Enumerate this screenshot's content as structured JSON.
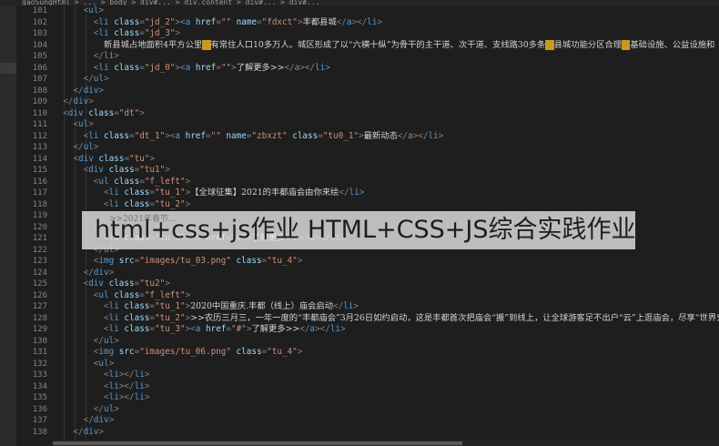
{
  "window": {
    "breadcrumb": "gaoSungHtml > ... > body > div#... > div.content > div#... > div#..."
  },
  "editor": {
    "lines": [
      {
        "n": "101",
        "indent": 6,
        "tokens": [
          [
            "p",
            "<"
          ],
          [
            "tag",
            "ul"
          ],
          [
            "p",
            ">"
          ]
        ]
      },
      {
        "n": "102",
        "indent": 8,
        "tokens": [
          [
            "p",
            "<"
          ],
          [
            "tag",
            "li"
          ],
          [
            "attr",
            " class"
          ],
          [
            "p",
            "="
          ],
          [
            "str",
            "\"jd_2\""
          ],
          [
            "p",
            "><"
          ],
          [
            "tag",
            "a"
          ],
          [
            "attr",
            " href"
          ],
          [
            "p",
            "="
          ],
          [
            "str",
            "\"\""
          ],
          [
            "attr",
            " name"
          ],
          [
            "p",
            "="
          ],
          [
            "str",
            "\"fdxct\""
          ],
          [
            "p",
            ">"
          ],
          [
            "txt",
            "丰都县城"
          ],
          [
            "p",
            "</"
          ],
          [
            "tag",
            "a"
          ],
          [
            "p",
            "></"
          ],
          [
            "tag",
            "li"
          ],
          [
            "p",
            ">"
          ]
        ]
      },
      {
        "n": "103",
        "indent": 8,
        "tokens": [
          [
            "p",
            "<"
          ],
          [
            "tag",
            "li"
          ],
          [
            "attr",
            " class"
          ],
          [
            "p",
            "="
          ],
          [
            "str",
            "\"jd_3\""
          ],
          [
            "p",
            ">"
          ]
        ]
      },
      {
        "n": "104",
        "indent": 10,
        "tokens": [
          [
            "txt",
            "新县城占地面积4平方公里"
          ],
          [
            "hl",
            "，"
          ],
          [
            "txt",
            "有常住人口10多万人。城区形成了以“六横十纵”为骨干的主干道、次干道、支线路30多条"
          ],
          [
            "hl",
            "，"
          ],
          [
            "txt",
            "县城功能分区合理"
          ],
          [
            "hl",
            "，"
          ],
          [
            "txt",
            "基础设施、公益设施和"
          ]
        ]
      },
      {
        "n": "105",
        "indent": 8,
        "tokens": [
          [
            "p",
            "</"
          ],
          [
            "tag",
            "li"
          ],
          [
            "p",
            ">"
          ]
        ]
      },
      {
        "n": "106",
        "indent": 8,
        "tokens": [
          [
            "p",
            "<"
          ],
          [
            "tag",
            "li"
          ],
          [
            "attr",
            " class"
          ],
          [
            "p",
            "="
          ],
          [
            "str",
            "\"jd_0\""
          ],
          [
            "p",
            "><"
          ],
          [
            "tag",
            "a"
          ],
          [
            "attr",
            " href"
          ],
          [
            "p",
            "="
          ],
          [
            "str",
            "\"\""
          ],
          [
            "p",
            ">"
          ],
          [
            "txt",
            "了解更多>>"
          ],
          [
            "p",
            "</"
          ],
          [
            "tag",
            "a"
          ],
          [
            "p",
            "></"
          ],
          [
            "tag",
            "li"
          ],
          [
            "p",
            ">"
          ]
        ]
      },
      {
        "n": "107",
        "indent": 6,
        "tokens": [
          [
            "p",
            "</"
          ],
          [
            "tag",
            "ul"
          ],
          [
            "p",
            ">"
          ]
        ]
      },
      {
        "n": "108",
        "indent": 4,
        "tokens": [
          [
            "p",
            "</"
          ],
          [
            "tag",
            "div"
          ],
          [
            "p",
            ">"
          ]
        ]
      },
      {
        "n": "109",
        "indent": 2,
        "tokens": [
          [
            "p",
            "</"
          ],
          [
            "tag",
            "div"
          ],
          [
            "p",
            ">"
          ]
        ]
      },
      {
        "n": "110",
        "indent": 2,
        "tokens": [
          [
            "p",
            "<"
          ],
          [
            "tag",
            "div"
          ],
          [
            "attr",
            " class"
          ],
          [
            "p",
            "="
          ],
          [
            "str",
            "\"dt\""
          ],
          [
            "p",
            ">"
          ]
        ]
      },
      {
        "n": "111",
        "indent": 4,
        "tokens": [
          [
            "p",
            "<"
          ],
          [
            "tag",
            "ul"
          ],
          [
            "p",
            ">"
          ]
        ]
      },
      {
        "n": "112",
        "indent": 6,
        "tokens": [
          [
            "p",
            "<"
          ],
          [
            "tag",
            "li"
          ],
          [
            "attr",
            " class"
          ],
          [
            "p",
            "="
          ],
          [
            "str",
            "\"dt_1\""
          ],
          [
            "p",
            "><"
          ],
          [
            "tag",
            "a"
          ],
          [
            "attr",
            " href"
          ],
          [
            "p",
            "="
          ],
          [
            "str",
            "\"\""
          ],
          [
            "attr",
            " name"
          ],
          [
            "p",
            "="
          ],
          [
            "str",
            "\"zbxzt\""
          ],
          [
            "attr",
            " class"
          ],
          [
            "p",
            "="
          ],
          [
            "str",
            "\"tu0_1\""
          ],
          [
            "p",
            ">"
          ],
          [
            "txt",
            "最新动态"
          ],
          [
            "p",
            "</"
          ],
          [
            "tag",
            "a"
          ],
          [
            "p",
            "></"
          ],
          [
            "tag",
            "li"
          ],
          [
            "p",
            ">"
          ]
        ]
      },
      {
        "n": "113",
        "indent": 4,
        "tokens": [
          [
            "p",
            "</"
          ],
          [
            "tag",
            "ul"
          ],
          [
            "p",
            ">"
          ]
        ]
      },
      {
        "n": "114",
        "indent": 4,
        "tokens": [
          [
            "p",
            "<"
          ],
          [
            "tag",
            "div"
          ],
          [
            "attr",
            " class"
          ],
          [
            "p",
            "="
          ],
          [
            "str",
            "\"tu\""
          ],
          [
            "p",
            ">"
          ]
        ]
      },
      {
        "n": "115",
        "indent": 6,
        "tokens": [
          [
            "p",
            "<"
          ],
          [
            "tag",
            "div"
          ],
          [
            "attr",
            " class"
          ],
          [
            "p",
            "="
          ],
          [
            "str",
            "\"tu1\""
          ],
          [
            "p",
            ">"
          ]
        ]
      },
      {
        "n": "116",
        "indent": 8,
        "tokens": [
          [
            "p",
            "<"
          ],
          [
            "tag",
            "ul"
          ],
          [
            "attr",
            " class"
          ],
          [
            "p",
            "="
          ],
          [
            "str",
            "\"f_left\""
          ],
          [
            "p",
            ">"
          ]
        ]
      },
      {
        "n": "117",
        "indent": 10,
        "tokens": [
          [
            "p",
            "<"
          ],
          [
            "tag",
            "li"
          ],
          [
            "attr",
            " class"
          ],
          [
            "p",
            "="
          ],
          [
            "str",
            "\"tu_1\""
          ],
          [
            "p",
            ">"
          ],
          [
            "txt",
            "【全球征集】2021的丰都庙会由你来绘"
          ],
          [
            "p",
            "</"
          ],
          [
            "tag",
            "li"
          ],
          [
            "p",
            ">"
          ]
        ]
      },
      {
        "n": "118",
        "indent": 10,
        "tokens": [
          [
            "p",
            "<"
          ],
          [
            "tag",
            "li"
          ],
          [
            "attr",
            " class"
          ],
          [
            "p",
            "="
          ],
          [
            "str",
            "\"tu_2\""
          ],
          [
            "p",
            ">"
          ]
        ]
      },
      {
        "n": "119",
        "indent": 12,
        "tokens": []
      },
      {
        "n": "120",
        "indent": 10,
        "tokens": []
      },
      {
        "n": "121",
        "indent": 10,
        "tokens": [
          [
            "p",
            "<"
          ],
          [
            "tag",
            "li"
          ],
          [
            "attr",
            " class"
          ],
          [
            "p",
            "="
          ],
          [
            "str",
            "\"tu_3\""
          ],
          [
            "p",
            "><"
          ],
          [
            "tag",
            "a"
          ],
          [
            "attr",
            " href"
          ],
          [
            "p",
            "="
          ],
          [
            "str",
            "\"#\""
          ],
          [
            "p",
            ">"
          ],
          [
            "txt",
            "了解更多>>"
          ],
          [
            "p",
            "</"
          ],
          [
            "tag",
            "a"
          ],
          [
            "p",
            "></"
          ],
          [
            "tag",
            "li"
          ],
          [
            "p",
            ">"
          ]
        ]
      },
      {
        "n": "122",
        "indent": 8,
        "tokens": [
          [
            "p",
            "</"
          ],
          [
            "tag",
            "ul"
          ],
          [
            "p",
            ">"
          ]
        ]
      },
      {
        "n": "123",
        "indent": 8,
        "tokens": [
          [
            "p",
            "<"
          ],
          [
            "tag",
            "img"
          ],
          [
            "attr",
            " src"
          ],
          [
            "p",
            "="
          ],
          [
            "str",
            "\"images/tu_03.png\""
          ],
          [
            "attr",
            " class"
          ],
          [
            "p",
            "="
          ],
          [
            "str",
            "\"tu_4\""
          ],
          [
            "p",
            ">"
          ]
        ]
      },
      {
        "n": "124",
        "indent": 6,
        "tokens": [
          [
            "p",
            "</"
          ],
          [
            "tag",
            "div"
          ],
          [
            "p",
            ">"
          ]
        ]
      },
      {
        "n": "125",
        "indent": 6,
        "tokens": [
          [
            "p",
            "<"
          ],
          [
            "tag",
            "div"
          ],
          [
            "attr",
            " class"
          ],
          [
            "p",
            "="
          ],
          [
            "str",
            "\"tu2\""
          ],
          [
            "p",
            ">"
          ]
        ]
      },
      {
        "n": "126",
        "indent": 8,
        "tokens": [
          [
            "p",
            "<"
          ],
          [
            "tag",
            "ul"
          ],
          [
            "attr",
            " class"
          ],
          [
            "p",
            "="
          ],
          [
            "str",
            "\"f_left\""
          ],
          [
            "p",
            ">"
          ]
        ]
      },
      {
        "n": "127",
        "indent": 10,
        "tokens": [
          [
            "p",
            "<"
          ],
          [
            "tag",
            "li"
          ],
          [
            "attr",
            " class"
          ],
          [
            "p",
            "="
          ],
          [
            "str",
            "\"tu_1\""
          ],
          [
            "p",
            ">"
          ],
          [
            "txt",
            "2020中国重庆.丰都（线上）庙会启动"
          ],
          [
            "p",
            "</"
          ],
          [
            "tag",
            "li"
          ],
          [
            "p",
            ">"
          ]
        ]
      },
      {
        "n": "128",
        "indent": 10,
        "tokens": [
          [
            "p",
            "<"
          ],
          [
            "tag",
            "li"
          ],
          [
            "attr",
            " class"
          ],
          [
            "p",
            "="
          ],
          [
            "str",
            "\"tu_2\""
          ],
          [
            "p",
            ">"
          ],
          [
            "txt",
            ">>农历三月三，一年一度的“丰都庙会”3月26日如约启动，这是丰都首次把庙会“搬”到线上，让全球游客足不出户“云”上逛庙会，尽享“世界鬼"
          ]
        ]
      },
      {
        "n": "129",
        "indent": 10,
        "tokens": [
          [
            "p",
            "<"
          ],
          [
            "tag",
            "li"
          ],
          [
            "attr",
            " class"
          ],
          [
            "p",
            "="
          ],
          [
            "str",
            "\"tu_3\""
          ],
          [
            "p",
            "><"
          ],
          [
            "tag",
            "a"
          ],
          [
            "attr",
            " href"
          ],
          [
            "p",
            "="
          ],
          [
            "str",
            "\"#\""
          ],
          [
            "p",
            ">"
          ],
          [
            "txt",
            "了解更多>>"
          ],
          [
            "p",
            "</"
          ],
          [
            "tag",
            "a"
          ],
          [
            "p",
            "></"
          ],
          [
            "tag",
            "li"
          ],
          [
            "p",
            ">"
          ]
        ]
      },
      {
        "n": "130",
        "indent": 8,
        "tokens": [
          [
            "p",
            "</"
          ],
          [
            "tag",
            "ul"
          ],
          [
            "p",
            ">"
          ]
        ]
      },
      {
        "n": "131",
        "indent": 8,
        "tokens": [
          [
            "p",
            "<"
          ],
          [
            "tag",
            "img"
          ],
          [
            "attr",
            " src"
          ],
          [
            "p",
            "="
          ],
          [
            "str",
            "\"images/tu_06.png\""
          ],
          [
            "attr",
            " class"
          ],
          [
            "p",
            "="
          ],
          [
            "str",
            "\"tu_4\""
          ],
          [
            "p",
            ">"
          ]
        ]
      },
      {
        "n": "132",
        "indent": 8,
        "tokens": [
          [
            "p",
            "<"
          ],
          [
            "tag",
            "ul"
          ],
          [
            "p",
            ">"
          ]
        ]
      },
      {
        "n": "133",
        "indent": 10,
        "tokens": [
          [
            "p",
            "<"
          ],
          [
            "tag",
            "li"
          ],
          [
            "p",
            "></"
          ],
          [
            "tag",
            "li"
          ],
          [
            "p",
            ">"
          ]
        ]
      },
      {
        "n": "134",
        "indent": 10,
        "tokens": [
          [
            "p",
            "<"
          ],
          [
            "tag",
            "li"
          ],
          [
            "p",
            "></"
          ],
          [
            "tag",
            "li"
          ],
          [
            "p",
            ">"
          ]
        ]
      },
      {
        "n": "135",
        "indent": 10,
        "tokens": [
          [
            "p",
            "<"
          ],
          [
            "tag",
            "li"
          ],
          [
            "p",
            "></"
          ],
          [
            "tag",
            "li"
          ],
          [
            "p",
            ">"
          ]
        ]
      },
      {
        "n": "136",
        "indent": 8,
        "tokens": [
          [
            "p",
            "</"
          ],
          [
            "tag",
            "ul"
          ],
          [
            "p",
            ">"
          ]
        ]
      },
      {
        "n": "137",
        "indent": 6,
        "tokens": [
          [
            "p",
            "</"
          ],
          [
            "tag",
            "div"
          ],
          [
            "p",
            ">"
          ]
        ]
      },
      {
        "n": "138",
        "indent": 4,
        "tokens": [
          [
            "p",
            "</"
          ],
          [
            "tag",
            "div"
          ],
          [
            "p",
            ">"
          ]
        ]
      }
    ],
    "overlapped_line": ">>2021年春节..."
  },
  "overlay": {
    "title": "html+css+js作业   HTML+CSS+JS综合实践作业集锦"
  },
  "colors": {
    "background": "#1e1e1e",
    "tag": "#569cd6",
    "attribute": "#9cdcfe",
    "string": "#ce9178",
    "highlight": "#c89b1a"
  }
}
